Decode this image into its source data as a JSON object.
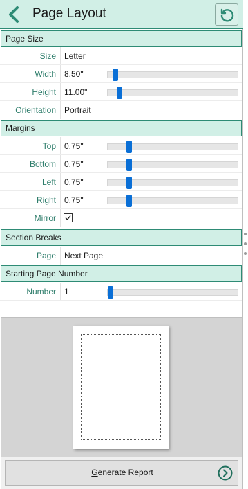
{
  "header": {
    "title": "Page Layout"
  },
  "sections": {
    "page_size": {
      "title": "Page Size",
      "size_label": "Size",
      "size_value": "Letter",
      "width_label": "Width",
      "width_value": "8.50\"",
      "width_level": 0.04,
      "height_label": "Height",
      "height_value": "11.00\"",
      "height_level": 0.07,
      "orientation_label": "Orientation",
      "orientation_value": "Portrait"
    },
    "margins": {
      "title": "Margins",
      "top_label": "Top",
      "top_value": "0.75\"",
      "top_level": 0.15,
      "bottom_label": "Bottom",
      "bottom_value": "0.75\"",
      "bottom_level": 0.15,
      "left_label": "Left",
      "left_value": "0.75\"",
      "left_level": 0.15,
      "right_label": "Right",
      "right_value": "0.75\"",
      "right_level": 0.15,
      "mirror_label": "Mirror",
      "mirror_checked": true
    },
    "section_breaks": {
      "title": "Section Breaks",
      "page_label": "Page",
      "page_value": "Next Page"
    },
    "starting_page_number": {
      "title": "Starting Page Number",
      "number_label": "Number",
      "number_value": "1",
      "number_level": 0.0
    }
  },
  "footer": {
    "generate_label": "Generate Report"
  },
  "colors": {
    "accent_green": "#2e8b75",
    "header_bg": "#d1efe6",
    "label_green": "#2e7d6b",
    "slider_thumb": "#0a6fd6"
  },
  "icons": {
    "back": "chevron-left-icon",
    "reset": "reset-icon",
    "generate": "circle-chevron-right-icon",
    "mirror": "checkmark-icon"
  }
}
